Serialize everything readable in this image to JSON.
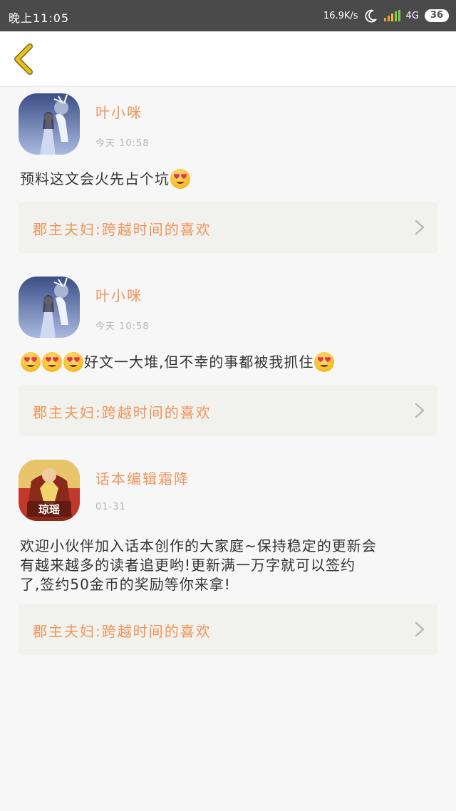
{
  "status_bar": {
    "time": "晚上11:05",
    "net_speed": "16.9K/s",
    "network": "4G",
    "battery": "36"
  },
  "nav": {
    "back_icon": "chevron-left-icon"
  },
  "colors": {
    "accent": "#f0955a",
    "card_bg": "#f1f1ed",
    "back_icon": "#e8c21a"
  },
  "comments": [
    {
      "user": "叶小咪",
      "date": "今天 10:58",
      "text": "预料这文会火先占个坑",
      "emoji_before": 0,
      "emoji_after": 1,
      "book_title": "郡主夫妇:跨越时间的喜欢"
    },
    {
      "user": "叶小咪",
      "date": "今天 10:58",
      "text": "好文一大堆,但不幸的事都被我抓住",
      "emoji_before": 3,
      "emoji_after": 1,
      "book_title": "郡主夫妇:跨越时间的喜欢"
    },
    {
      "user": "话本编辑霜降",
      "date": "01-31",
      "text_lines": [
        "欢迎小伙伴加入话本创作的大家庭~保持稳定的更新会",
        "有越来越多的读者追更哟!更新满一万字就可以签约",
        "了,签约50金币的奖励等你来拿!"
      ],
      "avatar_label": "琼瑶",
      "book_title": "郡主夫妇:跨越时间的喜欢"
    }
  ]
}
